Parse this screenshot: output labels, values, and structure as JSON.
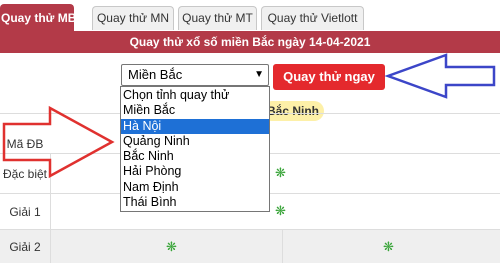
{
  "tabs": [
    {
      "label": "Quay thử MB",
      "active": true
    },
    {
      "label": "Quay thử MN",
      "active": false
    },
    {
      "label": "Quay thử MT",
      "active": false
    },
    {
      "label": "Quay thử Vietlott",
      "active": false
    }
  ],
  "header": {
    "title": "Quay thử xổ số miền Bắc ngày 14-04-2021"
  },
  "controls": {
    "selected_region": "Miền Bắc",
    "spin_button_label": "Quay thử ngay",
    "province_tag": "Bắc Ninh"
  },
  "dropdown": {
    "options": [
      "Chọn tỉnh quay thử",
      "Miền Bắc",
      "Hà Nội",
      "Quảng Ninh",
      "Bắc Ninh",
      "Hải Phòng",
      "Nam Định",
      "Thái Bình"
    ],
    "highlighted_index": 2
  },
  "table": {
    "rows": [
      {
        "label": "Mã ĐB"
      },
      {
        "label": "Đặc biệt"
      },
      {
        "label": "Giải 1"
      },
      {
        "label": "Giải 2"
      }
    ]
  },
  "colors": {
    "brand_red": "#b33a48",
    "button_red": "#e4292d",
    "annotation_arrow_red": "#e0312f",
    "annotation_arrow_blue": "#3c46c8",
    "loading_icon_green": "#3aa53a",
    "highlight_blue": "#1e70d6"
  },
  "icons": [
    "chevron-down-icon",
    "loading-spinner-icon",
    "red-arrow-annotation",
    "blue-arrow-annotation"
  ]
}
